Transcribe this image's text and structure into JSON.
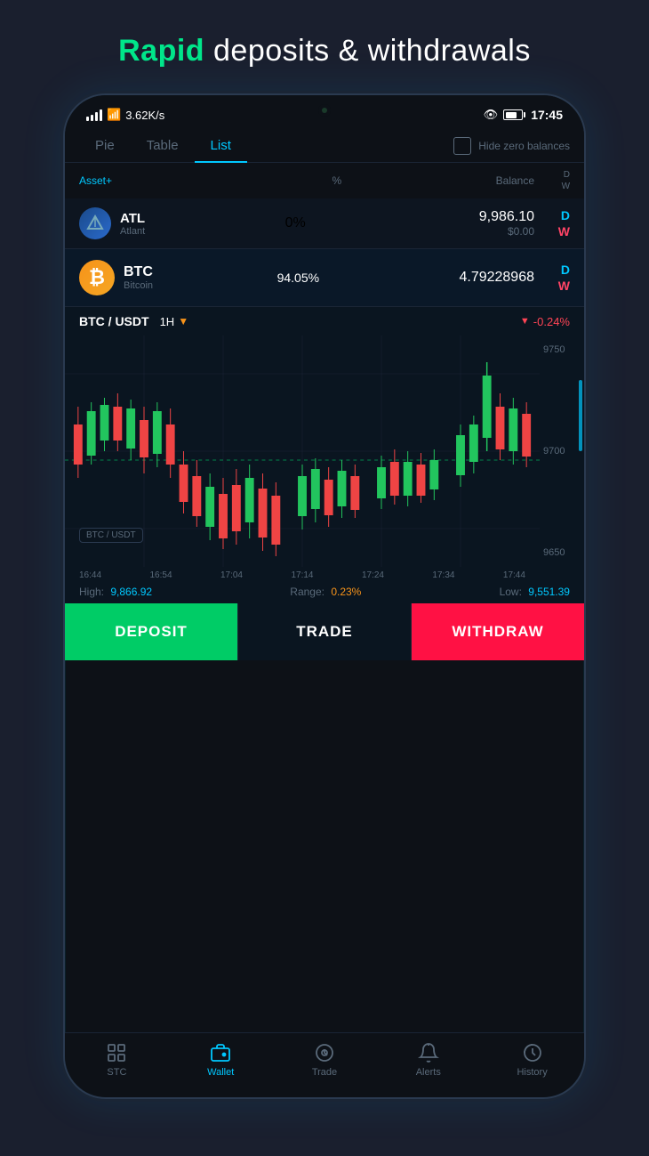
{
  "page": {
    "title_rapid": "Rapid",
    "title_rest": " deposits & withdrawals"
  },
  "status_bar": {
    "signal": "▋▋▋",
    "network_speed": "3.62K/s",
    "time": "17:45",
    "battery_pct": 51
  },
  "tabs": {
    "items": [
      {
        "label": "Pie",
        "active": false
      },
      {
        "label": "Table",
        "active": false
      },
      {
        "label": "List",
        "active": true
      }
    ],
    "hide_zero_label": "Hide zero balances"
  },
  "table_header": {
    "asset": "Asset+",
    "pct": "%",
    "balance": "Balance",
    "dw": "D\nW"
  },
  "atl_row": {
    "symbol": "ATL",
    "fullname": "Atlant",
    "pct": "0%",
    "balance": "9,986.10",
    "balance_usd": "$0.00",
    "d_label": "D",
    "w_label": "W"
  },
  "btc_row": {
    "symbol": "BTC",
    "fullname": "Bitcoin",
    "pct": "94.05%",
    "balance": "4.79228968",
    "d_label": "D",
    "w_label": "W"
  },
  "chart": {
    "pair": "BTC / USDT",
    "timeframe": "1H",
    "change": "-0.24%",
    "price_high": "9750",
    "price_mid": "9700",
    "price_low": "9650",
    "times": [
      "16:44",
      "16:54",
      "17:04",
      "17:14",
      "17:24",
      "17:34",
      "17:44"
    ],
    "stat_high_label": "High:",
    "stat_high_val": "9,866.92",
    "stat_range_label": "Range:",
    "stat_range_val": "0.23%",
    "stat_low_label": "Low:",
    "stat_low_val": "9,551.39",
    "badge": "BTC / USDT"
  },
  "buttons": {
    "deposit": "DEPOSIT",
    "trade": "TRADE",
    "withdraw": "WITHDRAW"
  },
  "bottom_nav": {
    "items": [
      {
        "label": "STC",
        "icon": "grid",
        "active": false
      },
      {
        "label": "Wallet",
        "icon": "wallet",
        "active": true
      },
      {
        "label": "Trade",
        "icon": "trade",
        "active": false
      },
      {
        "label": "Alerts",
        "icon": "bell",
        "active": false
      },
      {
        "label": "History",
        "icon": "history",
        "active": false
      }
    ]
  }
}
